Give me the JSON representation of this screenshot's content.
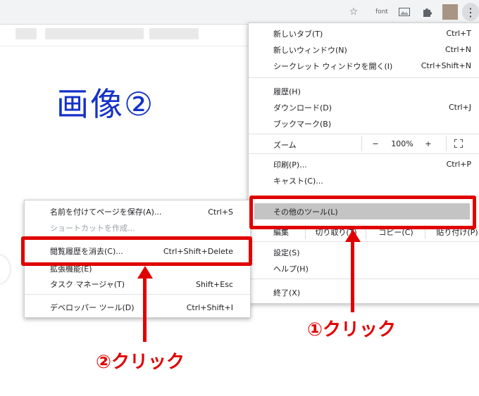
{
  "toolbar": {
    "font_label": "font",
    "icons": [
      "star-icon",
      "font-extension-icon",
      "image-extension-icon",
      "puzzle-icon",
      "avatar",
      "kebab-menu-icon"
    ]
  },
  "heading": "画像②",
  "main_menu": {
    "items_top": [
      {
        "label": "新しいタブ(T)",
        "shortcut": "Ctrl+T"
      },
      {
        "label": "新しいウィンドウ(N)",
        "shortcut": "Ctrl+N"
      },
      {
        "label": "シークレット ウィンドウを開く(I)",
        "shortcut": "Ctrl+Shift+N"
      }
    ],
    "items_mid": [
      {
        "label": "履歴(H)",
        "shortcut": ""
      },
      {
        "label": "ダウンロード(D)",
        "shortcut": "Ctrl+J"
      },
      {
        "label": "ブックマーク(B)",
        "shortcut": ""
      }
    ],
    "zoom": {
      "label": "ズーム",
      "minus": "−",
      "value": "100%",
      "plus": "+"
    },
    "items_print": [
      {
        "label": "印刷(P)...",
        "shortcut": "Ctrl+P"
      },
      {
        "label": "キャスト(C)...",
        "shortcut": ""
      }
    ],
    "more_tools": "その他のツール(L)",
    "edit_row": {
      "label": "編集",
      "cut": "切り取り(T)",
      "copy": "コピー(C)",
      "paste": "貼り付け(P)"
    },
    "items_bottom": [
      {
        "label": "設定(S)",
        "shortcut": ""
      },
      {
        "label": "ヘルプ(H)",
        "shortcut": ""
      }
    ],
    "exit": "終了(X)"
  },
  "sub_menu": {
    "items": [
      {
        "label": "名前を付けてページを保存(A)...",
        "shortcut": "Ctrl+S",
        "disabled": false
      },
      {
        "label": "ショートカットを作成...",
        "shortcut": "",
        "disabled": true
      },
      {
        "label": "閲覧履歴を消去(C)...",
        "shortcut": "Ctrl+Shift+Delete",
        "disabled": false
      },
      {
        "label": "拡張機能(E)",
        "shortcut": "",
        "disabled": false
      },
      {
        "label": "タスク マネージャ(T)",
        "shortcut": "Shift+Esc",
        "disabled": false
      },
      {
        "label": "デベロッパー ツール(D)",
        "shortcut": "Ctrl+Shift+I",
        "disabled": false
      }
    ]
  },
  "annotations": {
    "step1": "①クリック",
    "step2": "②クリック",
    "color": "#e00000"
  }
}
